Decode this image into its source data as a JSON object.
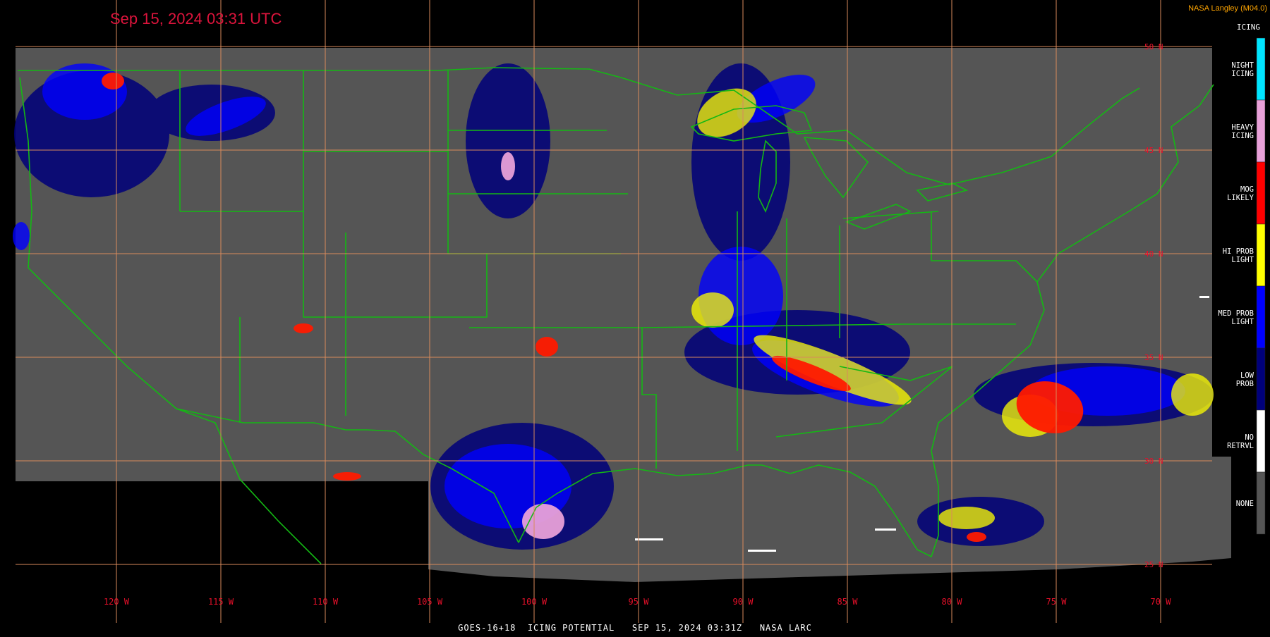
{
  "timestamp": "Sep 15, 2024 03:31 UTC",
  "credit": "NASA Langley (M04.0)",
  "legend_title": "ICING",
  "footer": "GOES-16+18  ICING POTENTIAL   SEP 15, 2024 03:31Z   NASA LARC",
  "longitudes": [
    "120 W",
    "115 W",
    "110 W",
    "105 W",
    "100 W",
    "95 W",
    "90 W",
    "85 W",
    "80 W",
    "75 W",
    "70 W"
  ],
  "latitudes": [
    "50 N",
    "45 N",
    "40 N",
    "35 N",
    "30 N",
    "25 N"
  ],
  "legend": [
    {
      "label": [
        "NIGHT",
        "ICING"
      ],
      "color": "#00e5ff"
    },
    {
      "label": [
        "HEAVY",
        "ICING"
      ],
      "color": "#e8a0d8"
    },
    {
      "label": [
        "MOG",
        "LIKELY"
      ],
      "color": "#ff0000"
    },
    {
      "label": [
        "HI PROB",
        "LIGHT"
      ],
      "color": "#ffff00"
    },
    {
      "label": [
        "MED PROB",
        "LIGHT"
      ],
      "color": "#0000ff"
    },
    {
      "label": [
        "LOW",
        "PROB"
      ],
      "color": "#00007a"
    },
    {
      "label": [
        "NO",
        "RETRVL"
      ],
      "color": "#ffffff"
    },
    {
      "label": [
        "NONE"
      ],
      "color": "#555555"
    }
  ],
  "colors": {
    "background": "#000000",
    "data_area": "#555555",
    "borders": "#14b814",
    "grid": "#d98a5c",
    "labels": "#e8102a"
  }
}
